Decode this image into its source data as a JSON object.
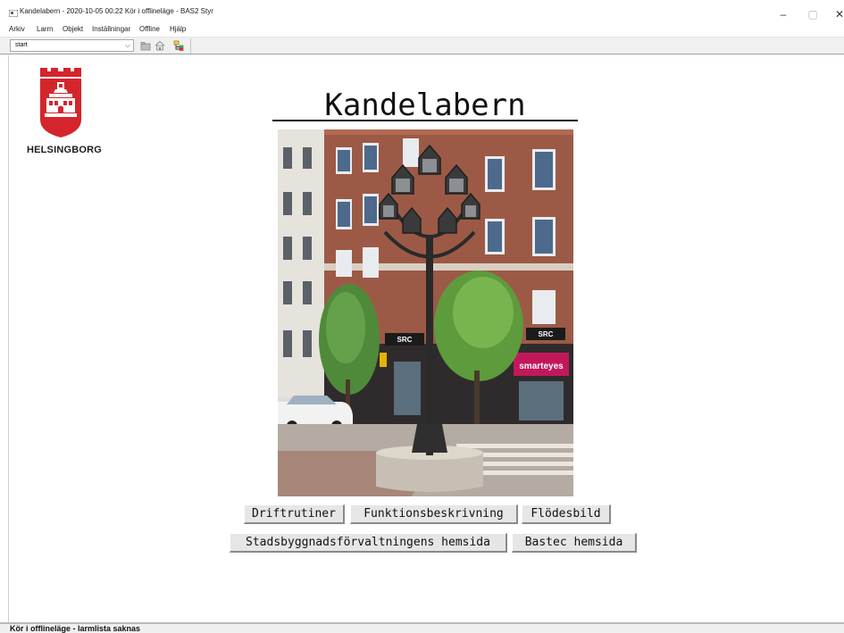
{
  "window": {
    "title": "Kandelabern  -  2020-10-05 00:22  Kör i offlineläge  - BAS2 Styr",
    "minimize": "–",
    "maximize": "▢",
    "close": "✕"
  },
  "menu": [
    "Arkiv",
    "Larm",
    "Objekt",
    "Inställningar",
    "Offline",
    "Hjälp"
  ],
  "toolbar": {
    "page_select_value": "start",
    "page_select_arrow": "⌵",
    "icons": [
      "folder-icon",
      "home-icon",
      "tree-icon"
    ]
  },
  "logo": {
    "text": "HELSINGBORG",
    "colors": {
      "crest_red": "#d4252c",
      "crest_white": "#ffffff"
    }
  },
  "page": {
    "title": "Kandelabern"
  },
  "buttons": {
    "driftrutiner": "Driftrutiner",
    "funktionsbeskrivning": "Funktionsbeskrivning",
    "flodesbild": "Flödesbild",
    "stadsbyggnad": "Stadsbyggnadsförvaltningens hemsida",
    "bastec": "Bastec hemsida"
  },
  "photo_signs": {
    "src_left": "SRC",
    "src_right": "SRC",
    "smarteyes": "smarteyes"
  },
  "status": {
    "text": "Kör i offlineläge - larmlista saknas"
  }
}
